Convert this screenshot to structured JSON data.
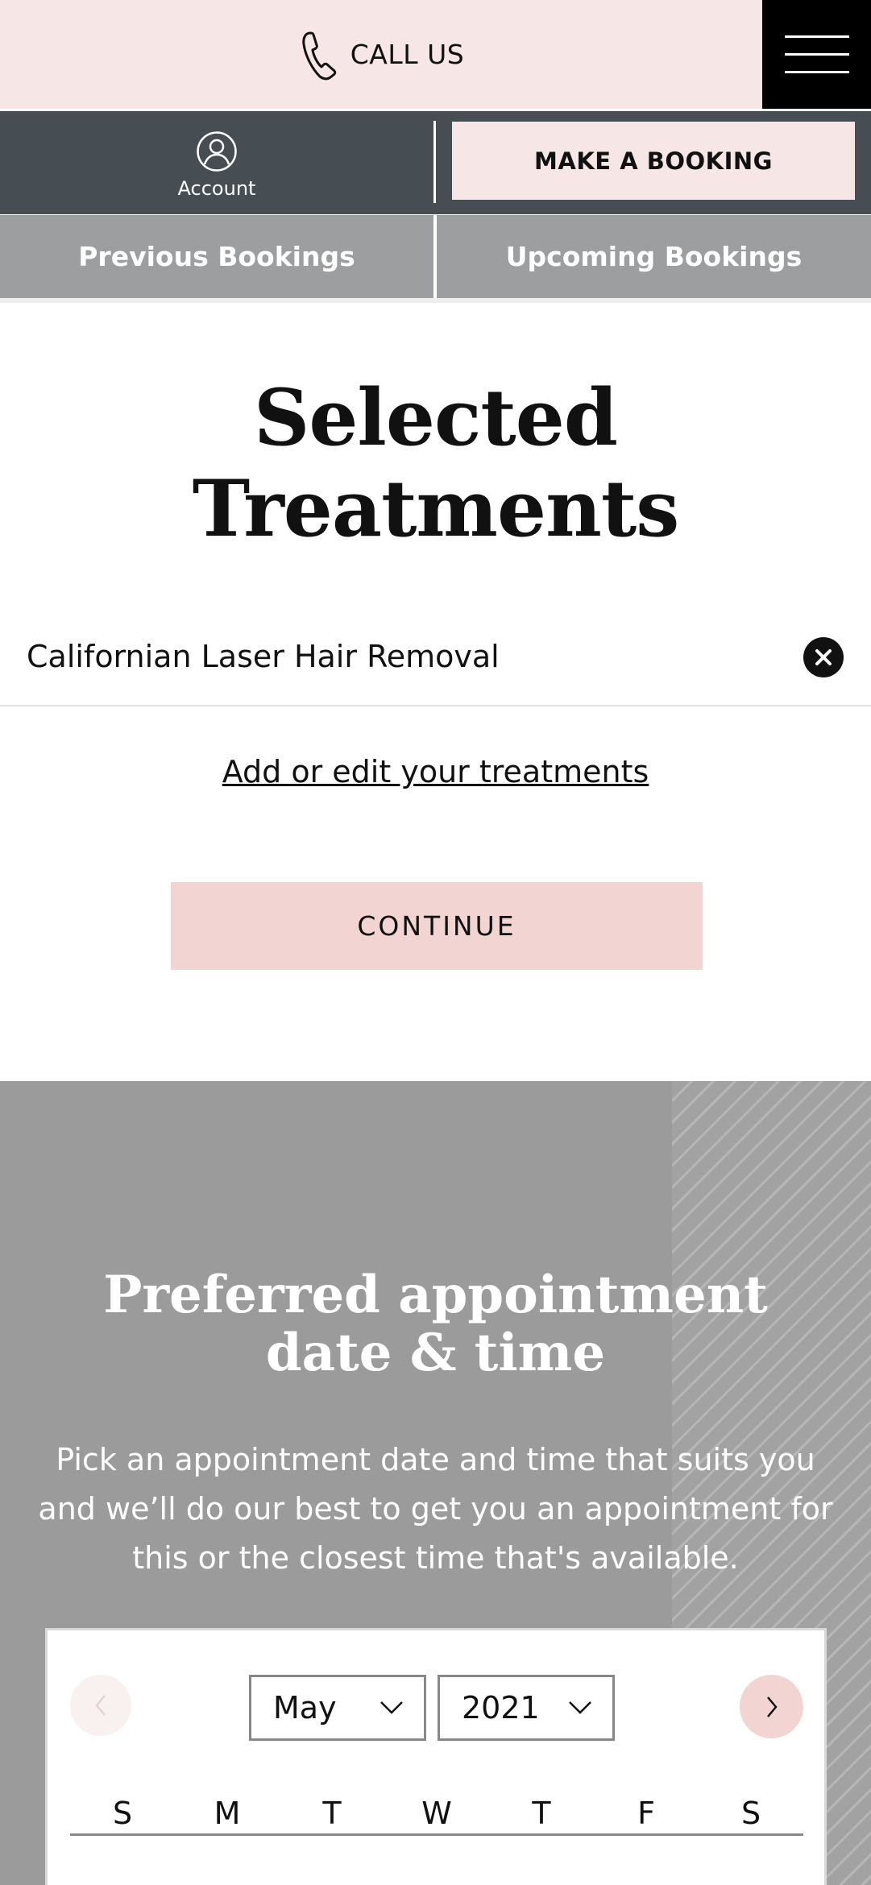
{
  "header": {
    "call_label": "CALL US",
    "account_label": "Account",
    "booking_button": "MAKE A BOOKING"
  },
  "bookings_nav": {
    "previous": "Previous Bookings",
    "upcoming": "Upcoming Bookings"
  },
  "selected": {
    "title": "Selected Treatments",
    "treatments": [
      {
        "name": "Californian Laser Hair Removal"
      }
    ],
    "add_link": "Add or edit your treatments",
    "continue_label": "CONTINUE"
  },
  "appointment": {
    "title": "Preferred appointment date & time",
    "description": "Pick an appointment date and time that suits you and we’ll do our best to get you an appointment for this or the closest time that's available."
  },
  "calendar": {
    "month": "May",
    "year": "2021",
    "weekdays": [
      "S",
      "M",
      "T",
      "W",
      "T",
      "F",
      "S"
    ]
  },
  "colors": {
    "pink_light": "#f6e6e5",
    "pink_button": "#f2d5d3",
    "slate": "#474e53",
    "grey": "#9b9b9c"
  }
}
